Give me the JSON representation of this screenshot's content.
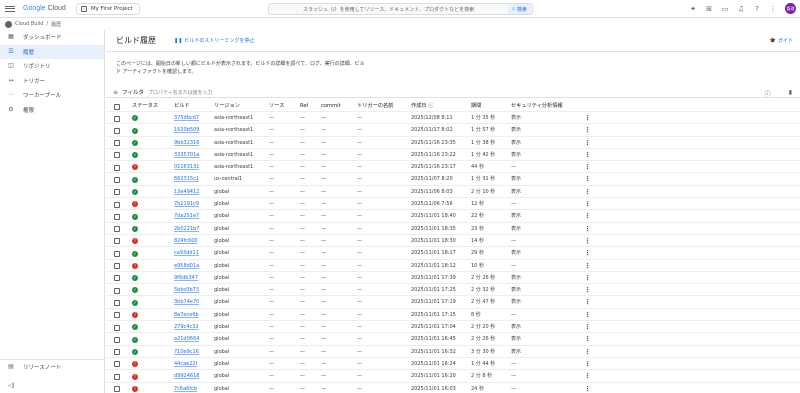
{
  "topbar": {
    "logo_google": "Google",
    "logo_cloud": " Cloud",
    "project": "My First Project",
    "search_placeholder": "スラッシュ（/）を使用してリソース、ドキュメント、プロダクトなどを検索",
    "search_button": "検索",
    "avatar_text": "管理"
  },
  "breadcrumb": {
    "service": "Cloud Build",
    "sep": "/",
    "page": "履歴"
  },
  "sidebar": {
    "items": [
      {
        "label": "ダッシュボード",
        "icon": "▦"
      },
      {
        "label": "履歴",
        "icon": "☰",
        "active": true
      },
      {
        "label": "リポジトリ",
        "icon": "◫"
      },
      {
        "label": "トリガー",
        "icon": "↔"
      },
      {
        "label": "ワーカープール",
        "icon": "⋯"
      },
      {
        "label": "権限",
        "icon": "⚙"
      }
    ],
    "release_notes": "リリースノート",
    "collapse": "◁|"
  },
  "main": {
    "title": "ビルド履歴",
    "stream_btn": "ビルドのストリーミングを停止",
    "guide_btn": "ガイド",
    "description": "このページには、開始日の新しい順にビルドが表示されます。ビルドの詳細を調べて、ログ、実行の詳細、ビルド アーティファクトを確認します。",
    "filter_label": "フィルタ",
    "filter_placeholder": "プロパティ名または値を入力"
  },
  "table": {
    "headers": {
      "status": "ステータス",
      "build": "ビルド",
      "region": "リージョン",
      "source": "ソース",
      "ref": "Ref",
      "commit": "commit",
      "trigger": "トリガーの名前",
      "created": "作成日 ⓘ",
      "duration": "期間",
      "security": "セキュリティ分析情報"
    },
    "rows": [
      {
        "status": "ok",
        "build": "375dbcd7",
        "region": "asia-northeast1",
        "source": "—",
        "ref": "—",
        "commit": "—",
        "trigger": "—",
        "created": "2025/12/08 8:11",
        "duration": "1 分 35 秒",
        "security": "表示"
      },
      {
        "status": "ok",
        "build": "1620b509",
        "region": "asia-northeast1",
        "source": "—",
        "ref": "—",
        "commit": "—",
        "trigger": "—",
        "created": "2025/11/17 8:02",
        "duration": "1 分 57 秒",
        "security": "表示"
      },
      {
        "status": "ok",
        "build": "9bb32316",
        "region": "asia-northeast1",
        "source": "—",
        "ref": "—",
        "commit": "—",
        "trigger": "—",
        "created": "2025/11/16 23:35",
        "duration": "1 分 38 秒",
        "security": "表示"
      },
      {
        "status": "ok",
        "build": "3335701a",
        "region": "asia-northeast1",
        "source": "—",
        "ref": "—",
        "commit": "—",
        "trigger": "—",
        "created": "2025/11/16 23:22",
        "duration": "1 分 42 秒",
        "security": "表示"
      },
      {
        "status": "err",
        "build": "01163131",
        "region": "asia-northeast1",
        "source": "—",
        "ref": "—",
        "commit": "—",
        "trigger": "—",
        "created": "2025/11/16 23:17",
        "duration": "44 秒",
        "security": "—"
      },
      {
        "status": "ok",
        "build": "662315c1",
        "region": "us-central1",
        "source": "—",
        "ref": "—",
        "commit": "—",
        "trigger": "—",
        "created": "2025/11/07 8:20",
        "duration": "1 分 31 秒",
        "security": "表示"
      },
      {
        "status": "ok",
        "build": "13e49412",
        "region": "global",
        "source": "—",
        "ref": "—",
        "commit": "—",
        "trigger": "—",
        "created": "2025/11/06 8:03",
        "duration": "2 分 10 秒",
        "security": "表示"
      },
      {
        "status": "err",
        "build": "7b1191c9",
        "region": "global",
        "source": "—",
        "ref": "—",
        "commit": "—",
        "trigger": "—",
        "created": "2025/11/06 7:56",
        "duration": "12 秒",
        "security": "—"
      },
      {
        "status": "ok",
        "build": "7da251e7",
        "region": "global",
        "source": "—",
        "ref": "—",
        "commit": "—",
        "trigger": "—",
        "created": "2025/11/01 18:40",
        "duration": "22 秒",
        "security": "表示"
      },
      {
        "status": "ok",
        "build": "2b0221b7",
        "region": "global",
        "source": "—",
        "ref": "—",
        "commit": "—",
        "trigger": "—",
        "created": "2025/11/01 18:35",
        "duration": "23 秒",
        "security": "表示"
      },
      {
        "status": "err",
        "build": "824fc600",
        "region": "global",
        "source": "—",
        "ref": "—",
        "commit": "—",
        "trigger": "—",
        "created": "2025/11/01 18:30",
        "duration": "14 秒",
        "security": "—"
      },
      {
        "status": "ok",
        "build": "ca93dd11",
        "region": "global",
        "source": "—",
        "ref": "—",
        "commit": "—",
        "trigger": "—",
        "created": "2025/11/01 18:17",
        "duration": "29 秒",
        "security": "表示"
      },
      {
        "status": "err",
        "build": "e958d01a",
        "region": "global",
        "source": "—",
        "ref": "—",
        "commit": "—",
        "trigger": "—",
        "created": "2025/11/01 18:12",
        "duration": "10 秒",
        "security": "—"
      },
      {
        "status": "ok",
        "build": "9f6db347",
        "region": "global",
        "source": "—",
        "ref": "—",
        "commit": "—",
        "trigger": "—",
        "created": "2025/11/01 17:39",
        "duration": "2 分 26 秒",
        "security": "表示"
      },
      {
        "status": "ok",
        "build": "5bbc0b73",
        "region": "global",
        "source": "—",
        "ref": "—",
        "commit": "—",
        "trigger": "—",
        "created": "2025/11/01 17:25",
        "duration": "2 分 32 秒",
        "security": "表示"
      },
      {
        "status": "ok",
        "build": "3bb74e70",
        "region": "global",
        "source": "—",
        "ref": "—",
        "commit": "—",
        "trigger": "—",
        "created": "2025/11/01 17:19",
        "duration": "2 分 47 秒",
        "security": "表示"
      },
      {
        "status": "err",
        "build": "8a7ece6b",
        "region": "global",
        "source": "—",
        "ref": "—",
        "commit": "—",
        "trigger": "—",
        "created": "2025/11/01 17:15",
        "duration": "8 秒",
        "security": "—"
      },
      {
        "status": "ok",
        "build": "279c4c32",
        "region": "global",
        "source": "—",
        "ref": "—",
        "commit": "—",
        "trigger": "—",
        "created": "2025/11/01 17:04",
        "duration": "2 分 20 秒",
        "security": "表示"
      },
      {
        "status": "ok",
        "build": "a21d0664",
        "region": "global",
        "source": "—",
        "ref": "—",
        "commit": "—",
        "trigger": "—",
        "created": "2025/11/01 16:45",
        "duration": "2 分 26 秒",
        "security": "表示"
      },
      {
        "status": "ok",
        "build": "710e9c16",
        "region": "global",
        "source": "—",
        "ref": "—",
        "commit": "—",
        "trigger": "—",
        "created": "2025/11/01 16:32",
        "duration": "3 分 30 秒",
        "security": "表示"
      },
      {
        "status": "err",
        "build": "44cae22f",
        "region": "global",
        "source": "—",
        "ref": "—",
        "commit": "—",
        "trigger": "—",
        "created": "2025/11/01 16:24",
        "duration": "1 分 44 秒",
        "security": "—"
      },
      {
        "status": "err",
        "build": "d9924618",
        "region": "global",
        "source": "—",
        "ref": "—",
        "commit": "—",
        "trigger": "—",
        "created": "2025/11/01 16:20",
        "duration": "2 分 8 秒",
        "security": "—"
      },
      {
        "status": "err",
        "build": "7c6a6fcb",
        "region": "global",
        "source": "—",
        "ref": "—",
        "commit": "—",
        "trigger": "—",
        "created": "2025/11/01 16:03",
        "duration": "24 秒",
        "security": "—"
      }
    ]
  },
  "colors": {
    "accent": "#1a73e8",
    "success": "#1e8e3e",
    "error": "#d93025",
    "active_bg": "#e8f0fe"
  }
}
